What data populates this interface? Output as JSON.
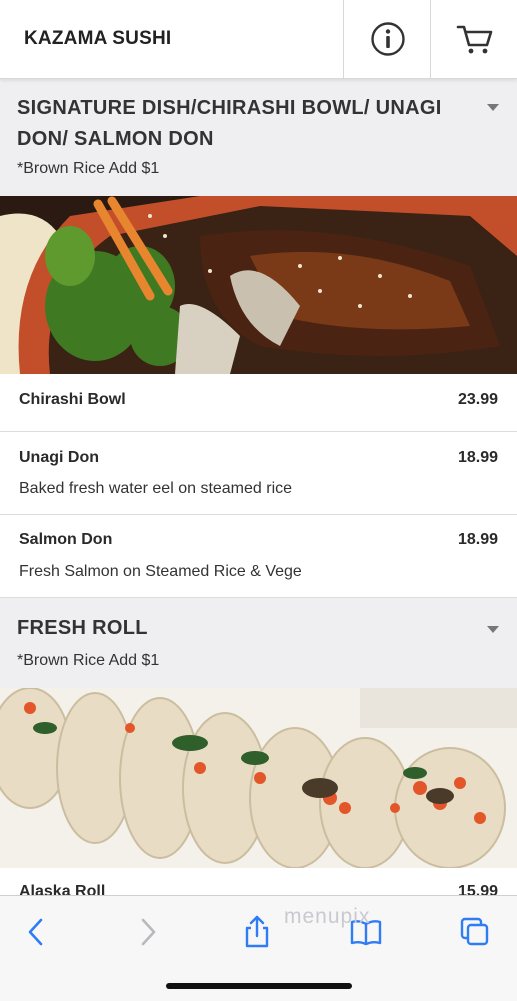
{
  "header": {
    "brand": "KAZAMA SUSHI",
    "info_icon": "info-icon",
    "cart_icon": "cart-icon"
  },
  "sections": [
    {
      "title_line1": "SIGNATURE DISH/CHIRASHI BOWL/ UNAGI",
      "title_line2": "DON/ SALMON DON",
      "note": "*Brown Rice Add $1",
      "items": [
        {
          "name": "Chirashi Bowl",
          "price": "23.99",
          "desc": ""
        },
        {
          "name": "Unagi Don",
          "price": "18.99",
          "desc": "Baked fresh water eel on steamed rice"
        },
        {
          "name": "Salmon Don",
          "price": "18.99",
          "desc": "Fresh Salmon on Steamed Rice & Vege"
        }
      ]
    },
    {
      "title_line1": "FRESH ROLL",
      "note": "*Brown Rice Add $1",
      "items": [
        {
          "name": "Alaska Roll",
          "price": "15.99"
        }
      ]
    }
  ],
  "watermark": "menupix",
  "toolbar": {
    "icons": [
      "back-icon",
      "forward-icon",
      "share-icon",
      "bookmarks-icon",
      "tabs-icon"
    ]
  },
  "colors": {
    "section_bg": "#efeff1",
    "accent_blue": "#2f7cf6"
  }
}
